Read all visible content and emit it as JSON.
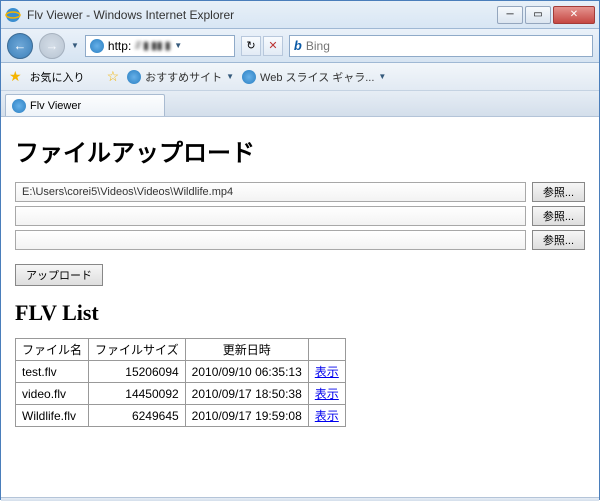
{
  "window": {
    "title": "Flv Viewer - Windows Internet Explorer"
  },
  "nav": {
    "url_scheme": "http:",
    "url_blurred": "// ▮ ▮▮ ▮",
    "search_engine": "Bing",
    "search_value": ""
  },
  "favbar": {
    "label": "お気に入り",
    "suggested": "おすすめサイト",
    "webslice": "Web スライス ギャラ..."
  },
  "tab": {
    "label": "Flv Viewer"
  },
  "page": {
    "upload_heading": "ファイルアップロード",
    "file_inputs": [
      "E:\\Users\\corei5\\Videos\\Videos\\Wildlife.mp4",
      "",
      ""
    ],
    "browse_label": "参照...",
    "upload_label": "アップロード",
    "list_heading": "FLV List",
    "table": {
      "headers": [
        "ファイル名",
        "ファイルサイズ",
        "更新日時",
        ""
      ],
      "rows": [
        {
          "name": "test.flv",
          "size": "15206094",
          "date": "2010/09/10 06:35:13",
          "action": "表示"
        },
        {
          "name": "video.flv",
          "size": "14450092",
          "date": "2010/09/17 18:50:38",
          "action": "表示"
        },
        {
          "name": "Wildlife.flv",
          "size": "6249645",
          "date": "2010/09/17 19:59:08",
          "action": "表示"
        }
      ]
    }
  }
}
